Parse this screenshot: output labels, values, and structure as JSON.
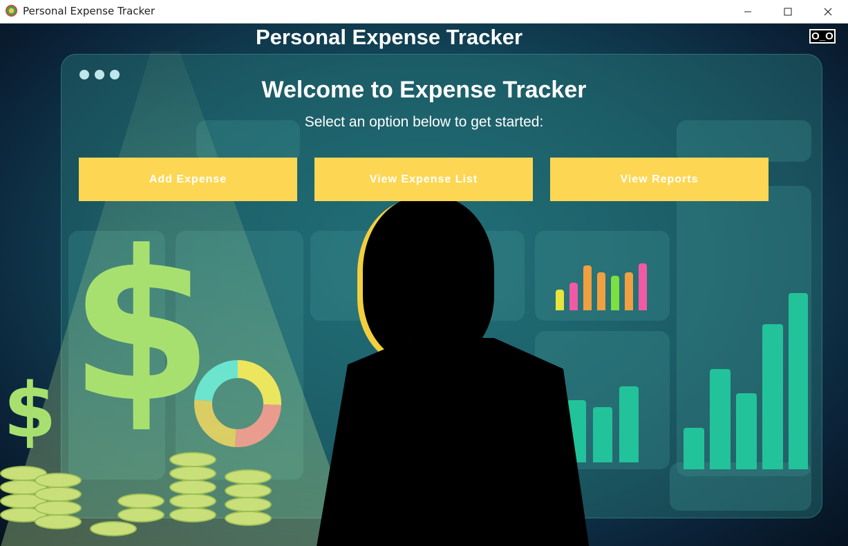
{
  "window": {
    "title": "Personal Expense Tracker",
    "minimize_glyph": "—",
    "maximize_glyph": "☐",
    "close_glyph": "✕"
  },
  "header": {
    "title": "Personal Expense Tracker",
    "corner_button_label": "O_O"
  },
  "main": {
    "welcome": "Welcome to Expense Tracker",
    "subtitle": "Select an option below to get started:",
    "buttons": [
      {
        "label": "Add Expense"
      },
      {
        "label": "View Expense List"
      },
      {
        "label": "View Reports"
      }
    ]
  },
  "colors": {
    "button_bg": "#fdd754",
    "button_text": "#ffffff",
    "header_text": "#ffffff"
  },
  "background_image": {
    "icons": [
      "dollar-sign-icon",
      "coin-stack-icon",
      "person-silhouette"
    ]
  }
}
